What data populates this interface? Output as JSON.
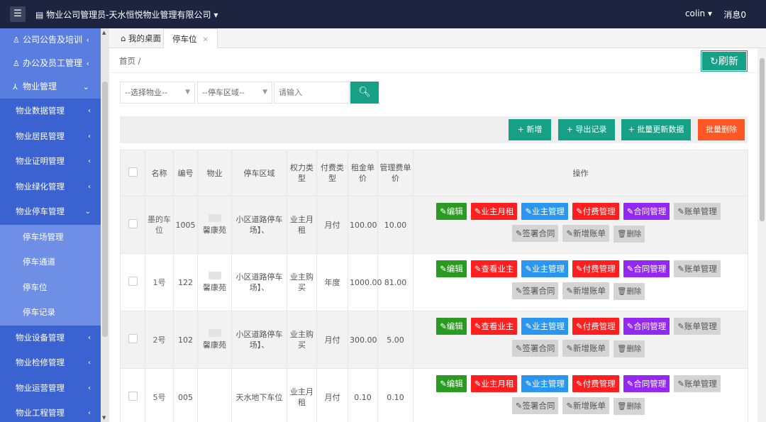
{
  "topbar": {
    "menu_glyph": "☰",
    "title": "物业公司管理员-天水恒悦物业管理有限公司",
    "user": "colin",
    "messages": "消息0"
  },
  "sidebar": {
    "top_items": [
      {
        "label": "公司公告及培训",
        "icon": "user-icon",
        "expanded": false
      },
      {
        "label": "办公及员工管理",
        "icon": "user-icon",
        "expanded": false
      },
      {
        "label": "物业管理",
        "icon": "tree-icon",
        "expanded": true
      }
    ],
    "sub_items": [
      {
        "label": "物业数据管理"
      },
      {
        "label": "物业居民管理"
      },
      {
        "label": "物业证明管理"
      },
      {
        "label": "物业绿化管理"
      },
      {
        "label": "物业停车管理",
        "expanded": true
      }
    ],
    "leaf_items": [
      {
        "label": "停车场管理"
      },
      {
        "label": "停车通道"
      },
      {
        "label": "停车位"
      },
      {
        "label": "停车记录"
      }
    ],
    "more_items": [
      {
        "label": "物业设备管理"
      },
      {
        "label": "物业检修管理"
      },
      {
        "label": "物业运营管理"
      },
      {
        "label": "物业工程管理"
      }
    ]
  },
  "tabs": {
    "home": "我的桌面",
    "active": "停车位",
    "close_glyph": "✕"
  },
  "breadcrumb": "首页 /",
  "refresh_label": "刷新",
  "filters": {
    "property_select": "--选择物业--",
    "area_select": "--停车区域--",
    "search_placeholder": "请输入"
  },
  "toolbar": {
    "add": "新增",
    "export": "导出记录",
    "batch_update": "批量更新数据",
    "batch_delete": "批量删除"
  },
  "table": {
    "headers": [
      "名称",
      "编号",
      "物业",
      "停车区域",
      "权力类型",
      "付费类型",
      "租金单价",
      "管理费单价",
      "操作"
    ],
    "rows": [
      {
        "name": "墨的车位",
        "code": "1005",
        "property": "馨康苑",
        "area": "小区道路停车场】、",
        "right_type": "业主月租",
        "pay_type": "月付",
        "rent": "100.00",
        "fee": "10.00",
        "ops": [
          "编辑",
          "业主月租",
          "业主管理",
          "付费管理",
          "合同管理",
          "账单管理",
          "签署合同",
          "新增账单",
          "删除"
        ]
      },
      {
        "name": "1号",
        "code": "122",
        "property": "馨康苑",
        "area": "小区道路停车场】、",
        "right_type": "业主购买",
        "pay_type": "年度",
        "rent": "1000.00",
        "fee": "81.00",
        "ops": [
          "编辑",
          "查看业主",
          "业主管理",
          "付费管理",
          "合同管理",
          "账单管理",
          "签署合同",
          "新增账单",
          "删除"
        ]
      },
      {
        "name": "2号",
        "code": "102",
        "property": "馨康苑",
        "area": "小区道路停车场】、",
        "right_type": "业主购买",
        "pay_type": "月付",
        "rent": "300.00",
        "fee": "5.00",
        "ops": [
          "编辑",
          "查看业主",
          "业主管理",
          "付费管理",
          "合同管理",
          "账单管理",
          "签署合同",
          "新增账单",
          "删除"
        ]
      },
      {
        "name": "5号",
        "code": "005",
        "property": "",
        "area": "天水地下车位",
        "right_type": "业主月租",
        "pay_type": "月付",
        "rent": "0.10",
        "fee": "0.10",
        "ops": [
          "编辑",
          "业主月租",
          "业主管理",
          "付费管理",
          "合同管理",
          "账单管理",
          "签署合同",
          "新增账单",
          "删除"
        ]
      }
    ]
  },
  "colors": {
    "topbar": "#1d2440",
    "sidebar": "#4a6fd5",
    "primary": "#16a085",
    "danger": "#ff5722",
    "edit": "#2b9a22",
    "red": "#ff1f1f",
    "blue": "#2a96f0",
    "purple": "#9328f2"
  }
}
